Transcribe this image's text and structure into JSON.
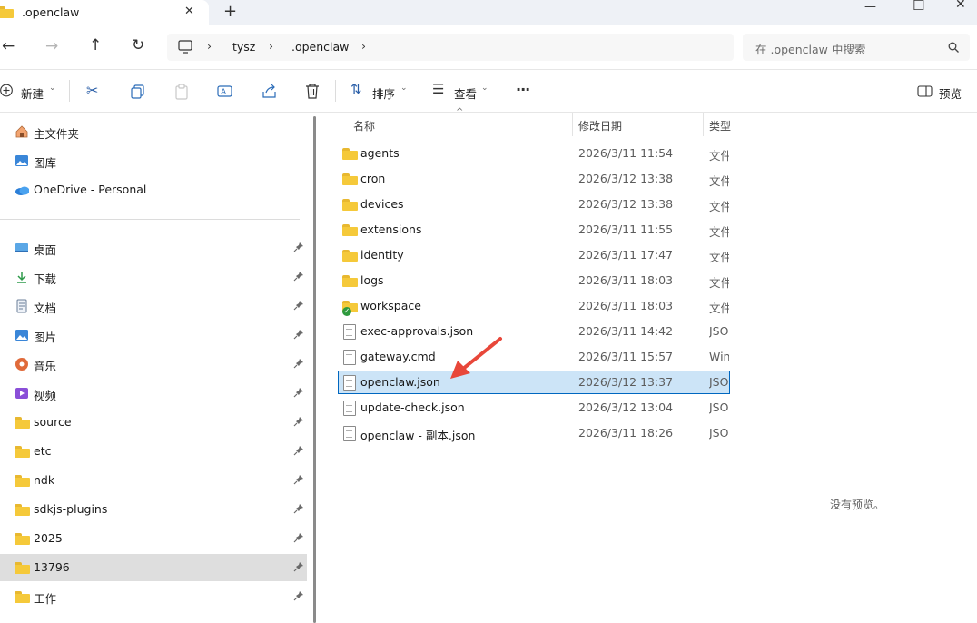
{
  "window": {
    "tab_title": ".openclaw",
    "close_tab": "✕",
    "new_tab": "+",
    "minimize": "—",
    "maximize": "☐",
    "close": "✕"
  },
  "address": {
    "breadcrumb": [
      "tysz",
      ".openclaw"
    ],
    "search_placeholder": "在 .openclaw 中搜索"
  },
  "toolbar": {
    "new_label": "新建",
    "sort_label": "排序",
    "view_label": "查看",
    "more_label": "···",
    "preview_label": "预览"
  },
  "sidebar": {
    "top": [
      {
        "label": "主文件夹",
        "icon": "home-icon"
      },
      {
        "label": "图库",
        "icon": "gallery-icon"
      },
      {
        "label": "OneDrive - Personal",
        "icon": "cloud-icon"
      }
    ],
    "pinned": [
      {
        "label": "桌面",
        "icon": "desktop-icon"
      },
      {
        "label": "下载",
        "icon": "download-icon"
      },
      {
        "label": "文档",
        "icon": "document-icon"
      },
      {
        "label": "图片",
        "icon": "picture-icon"
      },
      {
        "label": "音乐",
        "icon": "music-icon"
      },
      {
        "label": "视频",
        "icon": "video-icon"
      },
      {
        "label": "source",
        "icon": "folder-icon"
      },
      {
        "label": "etc",
        "icon": "folder-icon"
      },
      {
        "label": "ndk",
        "icon": "folder-icon"
      },
      {
        "label": "sdkjs-plugins",
        "icon": "folder-icon"
      },
      {
        "label": "2025",
        "icon": "folder-icon"
      },
      {
        "label": "13796",
        "icon": "folder-icon",
        "selected": true
      },
      {
        "label": "工作",
        "icon": "folder-icon"
      }
    ]
  },
  "columns": {
    "name": "名称",
    "modified": "修改日期",
    "type": "类型"
  },
  "files": [
    {
      "name": "agents",
      "modified": "2026/3/11 11:54",
      "type": "文件",
      "kind": "folder"
    },
    {
      "name": "cron",
      "modified": "2026/3/12 13:38",
      "type": "文件",
      "kind": "folder"
    },
    {
      "name": "devices",
      "modified": "2026/3/12 13:38",
      "type": "文件",
      "kind": "folder"
    },
    {
      "name": "extensions",
      "modified": "2026/3/11 11:55",
      "type": "文件",
      "kind": "folder"
    },
    {
      "name": "identity",
      "modified": "2026/3/11 17:47",
      "type": "文件",
      "kind": "folder"
    },
    {
      "name": "logs",
      "modified": "2026/3/11 18:03",
      "type": "文件",
      "kind": "folder"
    },
    {
      "name": "workspace",
      "modified": "2026/3/11 18:03",
      "type": "文件",
      "kind": "folder-synced"
    },
    {
      "name": "exec-approvals.json",
      "modified": "2026/3/11 14:42",
      "type": "JSO",
      "kind": "file"
    },
    {
      "name": "gateway.cmd",
      "modified": "2026/3/11 15:57",
      "type": "Win",
      "kind": "cmd"
    },
    {
      "name": "openclaw.json",
      "modified": "2026/3/12 13:37",
      "type": "JSO",
      "kind": "file",
      "selected": true
    },
    {
      "name": "update-check.json",
      "modified": "2026/3/12 13:04",
      "type": "JSO",
      "kind": "file"
    },
    {
      "name": "openclaw - 副本.json",
      "modified": "2026/3/11 18:26",
      "type": "JSO",
      "kind": "file"
    }
  ],
  "preview": {
    "empty_text": "没有预览。"
  },
  "colors": {
    "selection_bg": "#cce4f7",
    "selection_border": "#0067c0",
    "folder": "#f5c93a",
    "arrow": "#e8473a"
  }
}
